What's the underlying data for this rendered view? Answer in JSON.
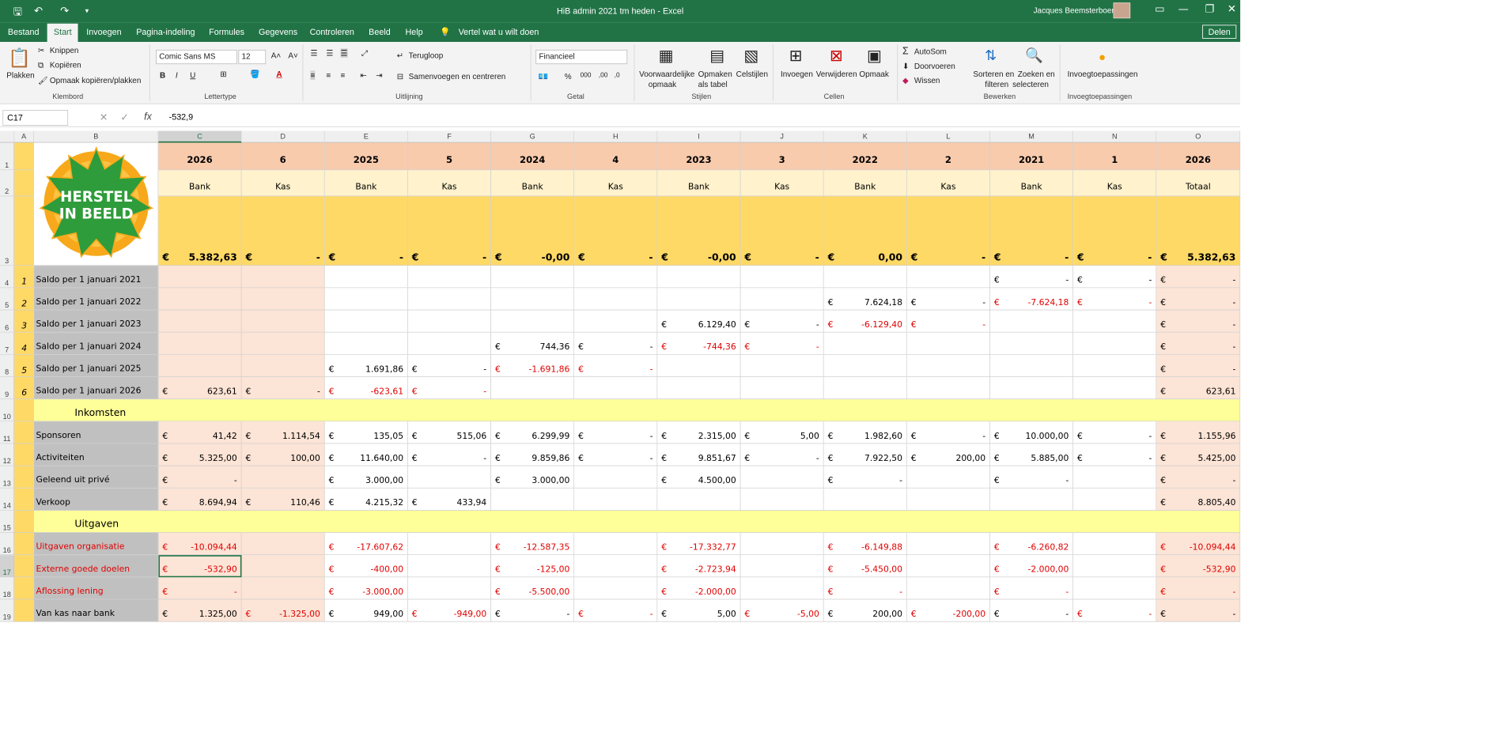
{
  "window": {
    "title": "HiB admin 2021 tm heden  -  Excel",
    "user": "Jacques Beemsterboer"
  },
  "tabs": [
    "Bestand",
    "Start",
    "Invoegen",
    "Pagina-indeling",
    "Formules",
    "Gegevens",
    "Controleren",
    "Beeld",
    "Help",
    "Vertel wat u wilt doen"
  ],
  "share_label": "Delen",
  "ribbon": {
    "klembord": {
      "plakken": "Plakken",
      "knippen": "Knippen",
      "kopieren": "Kopiëren",
      "opmaak": "Opmaak kopiëren/plakken",
      "label": "Klembord"
    },
    "lettertype": {
      "font": "Comic Sans MS",
      "size": "12",
      "label": "Lettertype"
    },
    "uitlijning": {
      "terugloop": "Terugloop",
      "samenvoegen": "Samenvoegen en centreren",
      "label": "Uitlijning"
    },
    "getal": {
      "format": "Financieel",
      "label": "Getal"
    },
    "stijlen": {
      "vw1": "Voorwaardelijke",
      "vw2": "opmaak",
      "tabel1": "Opmaken",
      "tabel2": "als tabel",
      "cel": "Celstijlen",
      "label": "Stijlen"
    },
    "cellen": {
      "invoegen": "Invoegen",
      "verwijderen": "Verwijderen",
      "opmaak": "Opmaak",
      "label": "Cellen"
    },
    "bewerken": {
      "autosom": "AutoSom",
      "doorvoeren": "Doorvoeren",
      "wissen": "Wissen",
      "sort1": "Sorteren en",
      "sort2": "filteren",
      "zoek1": "Zoeken en",
      "zoek2": "selecteren",
      "label": "Bewerken"
    },
    "invoeg": {
      "btn": "Invoegtoepassingen",
      "label": "Invoegtoepassingen"
    }
  },
  "formula_bar": {
    "name_box": "C17",
    "fx": "fx",
    "value": "-532,9"
  },
  "logo_text": [
    "HERSTEL",
    "IN BEELD"
  ],
  "columns": [
    "A",
    "B",
    "C",
    "D",
    "E",
    "F",
    "G",
    "H",
    "I",
    "J",
    "K",
    "L",
    "M",
    "N",
    "O"
  ],
  "row_numbers": [
    "1",
    "2",
    "3",
    "4",
    "5",
    "6",
    "7",
    "8",
    "9",
    "10",
    "11",
    "12",
    "13",
    "14",
    "15",
    "16",
    "17",
    "18",
    "19"
  ],
  "header": {
    "years": [
      "2026",
      "6",
      "2025",
      "5",
      "2024",
      "4",
      "2023",
      "3",
      "2022",
      "2",
      "2021",
      "1",
      "2026"
    ],
    "types": [
      "Bank",
      "Kas",
      "Bank",
      "Kas",
      "Bank",
      "Kas",
      "Bank",
      "Kas",
      "Bank",
      "Kas",
      "Bank",
      "Kas",
      "Totaal"
    ],
    "totals": [
      "5.382,63",
      "-",
      "-",
      "-",
      "-0,00",
      "-",
      "-0,00",
      "-",
      "0,00",
      "-",
      "-",
      "-",
      "5.382,63"
    ]
  },
  "section_labels": {
    "inkomsten": "Inkomsten",
    "uitgaven": "Uitgaven"
  },
  "rows": [
    {
      "r": 4,
      "a": "1",
      "label": "Saldo per 1 januari 2021",
      "cells": {
        "M": "-",
        "N": "-",
        "O": "-"
      }
    },
    {
      "r": 5,
      "a": "2",
      "label": "Saldo per 1 januari 2022",
      "cells": {
        "K": "7.624,18",
        "L": "-",
        "M": "-7.624,18",
        "N": "-",
        "O": "-"
      },
      "neg": [
        "M",
        "N"
      ]
    },
    {
      "r": 6,
      "a": "3",
      "label": "Saldo per 1 januari 2023",
      "cells": {
        "I": "6.129,40",
        "J": "-",
        "K": "-6.129,40",
        "L": "-",
        "O": "-"
      },
      "neg": [
        "K",
        "L"
      ]
    },
    {
      "r": 7,
      "a": "4",
      "label": "Saldo per 1 januari 2024",
      "cells": {
        "G": "744,36",
        "H": "-",
        "I": "-744,36",
        "J": "-",
        "O": "-"
      },
      "neg": [
        "I",
        "J"
      ]
    },
    {
      "r": 8,
      "a": "5",
      "label": "Saldo per 1 januari 2025",
      "cells": {
        "E": "1.691,86",
        "F": "-",
        "G": "-1.691,86",
        "H": "-",
        "O": "-"
      },
      "neg": [
        "G",
        "H"
      ]
    },
    {
      "r": 9,
      "a": "6",
      "label": "Saldo per 1 januari 2026",
      "cells": {
        "C": "623,61",
        "D": "-",
        "E": "-623,61",
        "F": "-",
        "O": "623,61"
      },
      "neg": [
        "E",
        "F"
      ]
    },
    {
      "r": 11,
      "a": "",
      "label": "Sponsoren",
      "cells": {
        "C": "41,42",
        "D": "1.114,54",
        "E": "135,05",
        "F": "515,06",
        "G": "6.299,99",
        "H": "-",
        "I": "2.315,00",
        "J": "5,00",
        "K": "1.982,60",
        "L": "-",
        "M": "10.000,00",
        "N": "-",
        "O": "1.155,96"
      }
    },
    {
      "r": 12,
      "a": "",
      "label": "Activiteiten",
      "cells": {
        "C": "5.325,00",
        "D": "100,00",
        "E": "11.640,00",
        "F": "-",
        "G": "9.859,86",
        "H": "-",
        "I": "9.851,67",
        "J": "-",
        "K": "7.922,50",
        "L": "200,00",
        "M": "5.885,00",
        "N": "-",
        "O": "5.425,00"
      }
    },
    {
      "r": 13,
      "a": "",
      "label": "Geleend uit privé",
      "cells": {
        "C": "-",
        "E": "3.000,00",
        "G": "3.000,00",
        "I": "4.500,00",
        "K": "-",
        "M": "-",
        "O": "-"
      }
    },
    {
      "r": 14,
      "a": "",
      "label": "Verkoop",
      "cells": {
        "C": "8.694,94",
        "D": "110,46",
        "E": "4.215,32",
        "F": "433,94",
        "O": "8.805,40"
      }
    },
    {
      "r": 16,
      "a": "",
      "label": "Uitgaven organisatie",
      "redlabel": true,
      "cells": {
        "C": "-10.094,44",
        "E": "-17.607,62",
        "G": "-12.587,35",
        "I": "-17.332,77",
        "K": "-6.149,88",
        "M": "-6.260,82",
        "O": "-10.094,44"
      },
      "neg": [
        "C",
        "E",
        "G",
        "I",
        "K",
        "M",
        "O"
      ]
    },
    {
      "r": 17,
      "a": "",
      "label": "Externe goede doelen",
      "redlabel": true,
      "cells": {
        "C": "-532,90",
        "E": "-400,00",
        "G": "-125,00",
        "I": "-2.723,94",
        "K": "-5.450,00",
        "M": "-2.000,00",
        "O": "-532,90"
      },
      "neg": [
        "C",
        "E",
        "G",
        "I",
        "K",
        "M",
        "O"
      ]
    },
    {
      "r": 18,
      "a": "",
      "label": "Aflossing lening",
      "redlabel": true,
      "cells": {
        "C": "-",
        "E": "-3.000,00",
        "G": "-5.500,00",
        "I": "-2.000,00",
        "K": "-",
        "M": "-",
        "O": "-"
      },
      "neg": [
        "C",
        "E",
        "G",
        "I",
        "K",
        "M",
        "O"
      ]
    },
    {
      "r": 19,
      "a": "",
      "label": "Van kas naar bank",
      "cells": {
        "C": "1.325,00",
        "D": "-1.325,00",
        "E": "949,00",
        "F": "-949,00",
        "G": "-",
        "H": "-",
        "I": "5,00",
        "J": "-5,00",
        "K": "200,00",
        "L": "-200,00",
        "M": "-",
        "N": "-",
        "O": "-"
      },
      "neg": [
        "D",
        "F",
        "H",
        "J",
        "L",
        "N"
      ]
    }
  ],
  "colors": {
    "excel_green": "#217346",
    "salmon": "#f8cbad",
    "light_yellow": "#fff2cc",
    "gold": "#ffd966",
    "pink": "#fce4d6",
    "grey_label": "#c0c0c0",
    "yellow_band": "#ffff99",
    "negative": "#e00000"
  }
}
